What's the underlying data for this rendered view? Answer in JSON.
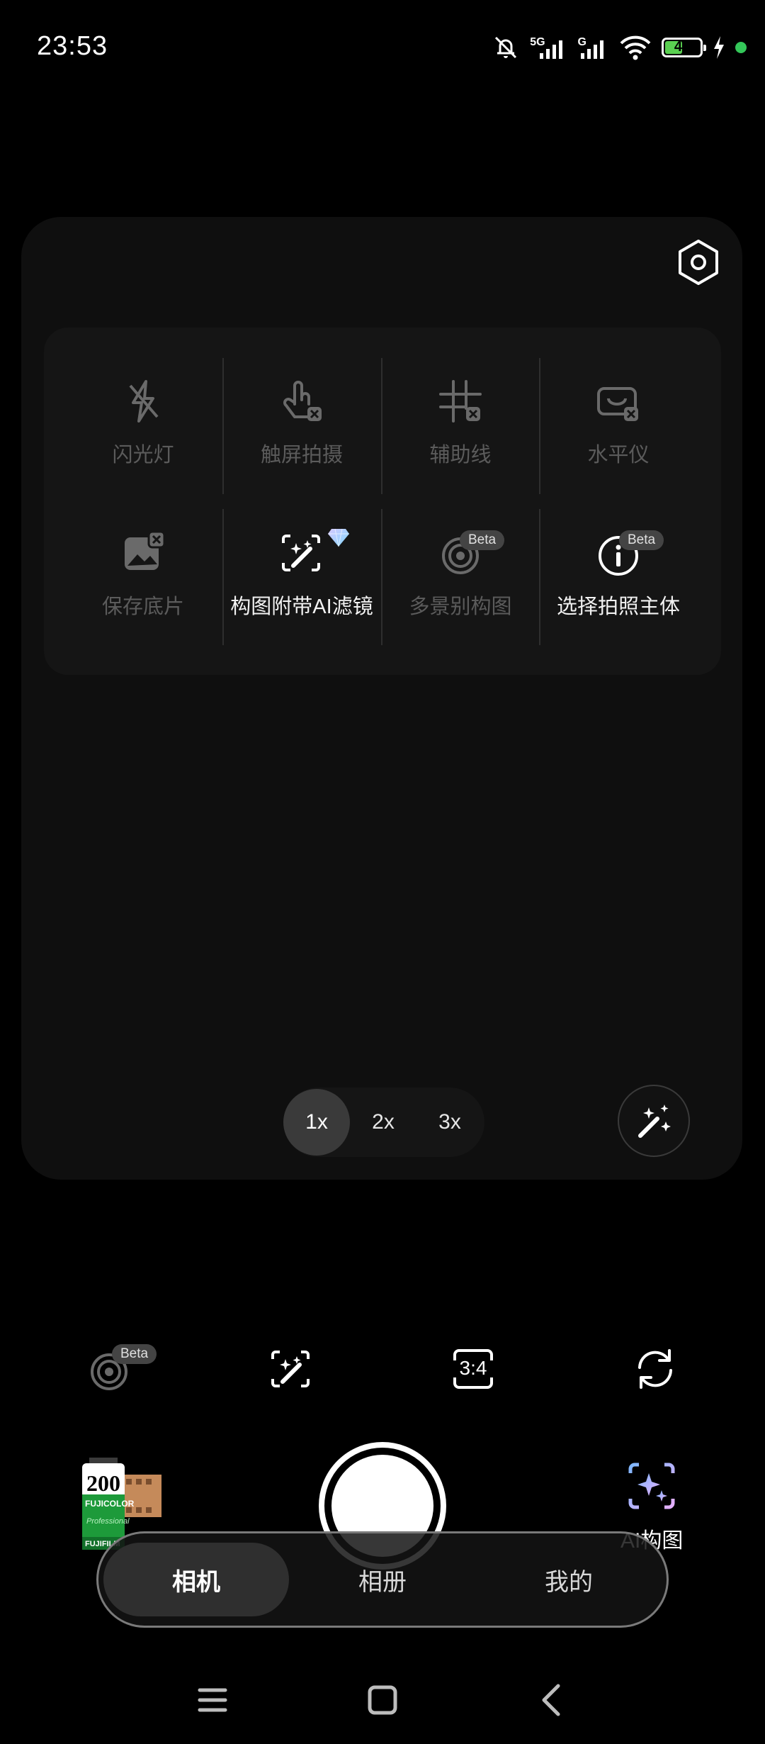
{
  "status_bar": {
    "time": "23:53",
    "signal1_label": "5G",
    "signal2_label": "G",
    "battery_level": "47",
    "icons": [
      "bell-muted-icon",
      "signal-5g-icon",
      "signal-g-icon",
      "wifi-icon",
      "battery-icon",
      "charging-bolt-icon",
      "privacy-dot-icon"
    ]
  },
  "colors": {
    "background": "#000000",
    "panel": "#0f0f0f",
    "battery_fill": "#5ad051",
    "privacy_dot": "#34c759",
    "dim_text": "#5b5b5b"
  },
  "settings": {
    "icon": "settings-hexagon-icon"
  },
  "quick_menu": {
    "row1": [
      {
        "label": "闪光灯",
        "icon": "flash-off-icon",
        "enabled": false
      },
      {
        "label": "触屏拍摄",
        "icon": "touch-shoot-icon",
        "enabled": false
      },
      {
        "label": "辅助线",
        "icon": "grid-lines-icon",
        "enabled": false
      },
      {
        "label": "水平仪",
        "icon": "level-icon",
        "enabled": false
      }
    ],
    "row2": [
      {
        "label": "保存底片",
        "icon": "save-negative-icon",
        "enabled": false
      },
      {
        "label": "构图附带AI滤镜",
        "icon": "ai-filter-wand-icon",
        "enabled": true,
        "badge_icon": "diamond-icon"
      },
      {
        "label": "多景别构图",
        "icon": "multi-scene-icon",
        "enabled": false,
        "badge": "Beta"
      },
      {
        "label": "选择拍照主体",
        "icon": "info-circle-icon",
        "enabled": true,
        "badge": "Beta"
      }
    ]
  },
  "zoom": {
    "options": [
      "1x",
      "2x",
      "3x"
    ],
    "selected": "1x"
  },
  "magic_button": {
    "icon": "magic-wand-sparkle-icon"
  },
  "tools": [
    {
      "icon": "multi-scene-icon",
      "badge": "Beta"
    },
    {
      "icon": "ai-filter-wand-icon"
    },
    {
      "icon": "aspect-ratio-icon",
      "label": "3:4"
    },
    {
      "icon": "switch-camera-icon"
    }
  ],
  "film_roll": {
    "number": "200",
    "brand": "FUJICOLOR",
    "sub": "Professional",
    "brand2": "FUJIFILM"
  },
  "ai_composition": {
    "label": "AI构图",
    "icon": "ai-sparkle-frame-icon"
  },
  "tabs": [
    {
      "label": "相机",
      "active": true
    },
    {
      "label": "相册",
      "active": false
    },
    {
      "label": "我的",
      "active": false
    }
  ],
  "nav": {
    "icons": [
      "menu-icon",
      "home-icon",
      "back-icon"
    ]
  }
}
